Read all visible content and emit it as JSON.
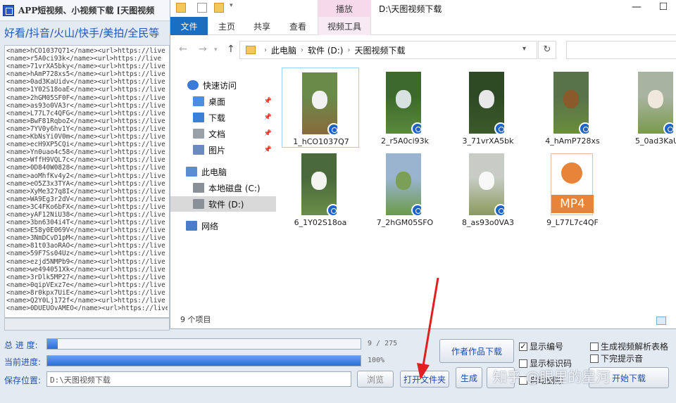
{
  "app": {
    "title": "APP短视频、小视频下载 [天图视频",
    "platforms": "好看/抖音/火山/快手/美拍/全民等",
    "log_lines": [
      "<name>hCO1037Q71</name><url>https://live",
      "<name>r5A0ci93k</name><url>https://live",
      "<name>71vrXA5bky</name><url>https://live",
      "<name>hAmP728xs5</name><url>https://live",
      "<name>0ad3KaUidv</name><url>https://live",
      "<name>1Y02S18oaE</name><url>https://live",
      "<name>2hGM05SF0F</name><url>https://live",
      "<name>as93o0VA3r</name><url>https://live",
      "<name>L77L7c4QFG</name><url>https://live",
      "<name>BwF81RqboZ</name><url>https://live",
      "<name>7YV0y6hv1Y</name><url>https://live",
      "<name>KbNsYi0V0m</name><url>https://live",
      "<name>ecH9XP5CQi</name><url>https://live",
      "<name>Yn0uao4c58</name><url>https://live",
      "<name>WffH9VQL7c</name><url>https://live",
      "<name>0D840W0828</name><url>https://live",
      "<name>aoMhfKv4y2</name><url>https://live",
      "<name>eO5Z3x3TYA</name><url>https://live",
      "<name>XyMe327q8I</name><url>https://live",
      "<name>WA9Eg3r2dV</name><url>https://live",
      "<name>3C4FKo6bFX</name><url>https://live",
      "<name>yAF12NiU38</name><url>https://live",
      "<name>3bn6304i4T</name><url>https://live",
      "<name>E58y0E069V</name><url>https://live",
      "<name>3NmDCvD1pM</name><url>https://live",
      "<name>81t03aoRAO</name><url>https://live",
      "<name>59F7Ss04Uz</name><url>https://live",
      "<name>ezjd5NMPb9</name><url>https://live",
      "<name>we494051Xk</name><url>https://live",
      "<name>3rDlk5MP27</name><url>https://live",
      "<name>0qipVExz7e</name><url>https://live",
      "<name>8r0kpx7UiE</name><url>https://live",
      "<name>Q2Y0Lj172f</name><url>https://live",
      "<name>0DUEUOvAMEO</name><url>https://live"
    ],
    "total_progress_label": "总 进 度:",
    "total_progress_text": "9 / 275",
    "total_progress_fraction": 0.033,
    "current_progress_label": "当前进度:",
    "current_progress_text": "100%",
    "current_progress_fraction": 1.0,
    "save_label": "保存位置:",
    "save_path": "D:\\天图视频下载",
    "browse_label": "浏览",
    "open_folder_label": "打开文件夹",
    "author_download_label": "作者作品下载",
    "generate_label": "生成",
    "start_label": "开始下载",
    "chk_show_number": "显示编号",
    "chk_show_id": "显示标识码",
    "chk_auto": "自动删除",
    "chk_gen_table": "生成视频解析表格",
    "chk_sound": "下完提示音",
    "watermark": "知乎 @眼里的星河"
  },
  "explorer": {
    "play_tab": "播放",
    "title_path": "D:\\天图视频下载",
    "ribbon_tabs": [
      "文件",
      "主页",
      "共享",
      "查看",
      "视频工具"
    ],
    "breadcrumb": [
      "此电脑",
      "软件 (D:)",
      "天图视频下载"
    ],
    "tree": [
      {
        "label": "快速访问",
        "icon": "star-icon",
        "pinned": false
      },
      {
        "label": "桌面",
        "icon": "desktop-icon",
        "pinned": true
      },
      {
        "label": "下载",
        "icon": "download-icon",
        "pinned": true
      },
      {
        "label": "文档",
        "icon": "document-icon",
        "pinned": true
      },
      {
        "label": "图片",
        "icon": "pictures-icon",
        "pinned": true
      },
      {
        "label": "此电脑",
        "icon": "computer-icon",
        "pinned": false
      },
      {
        "label": "本地磁盘 (C:)",
        "icon": "drive-icon",
        "pinned": false
      },
      {
        "label": "软件 (D:)",
        "icon": "drive-icon",
        "pinned": false
      },
      {
        "label": "网络",
        "icon": "network-icon",
        "pinned": false
      }
    ],
    "files": [
      {
        "name": "1_hCO1037Q7",
        "kind": "video",
        "sky": "#6a8a4a",
        "ground": "#8a6a3a",
        "subject": "#f2f2f2"
      },
      {
        "name": "2_r5A0ci93k",
        "kind": "video",
        "sky": "#3c6a2c",
        "ground": "#5a8a3c",
        "subject": "#d8e2e0"
      },
      {
        "name": "3_71vrXA5bk",
        "kind": "video",
        "sky": "#2e4a24",
        "ground": "#3c5a2a",
        "subject": "#e8e8e8"
      },
      {
        "name": "4_hAmP728xs",
        "kind": "video",
        "sky": "#58724a",
        "ground": "#6a8e3c",
        "subject": "#8a5a2a"
      },
      {
        "name": "5_0ad3KaU",
        "kind": "video",
        "sky": "#a8b4a0",
        "ground": "#7a9a4c",
        "subject": "#f0e8dc"
      },
      {
        "name": "6_1Y02S18oa",
        "kind": "video",
        "sky": "#4a6a3c",
        "ground": "#6a8e48",
        "subject": "#f4f4f0"
      },
      {
        "name": "7_2hGM05SFO",
        "kind": "video",
        "sky": "#9ab4d0",
        "ground": "#6a9a48",
        "subject": "#7aa058"
      },
      {
        "name": "8_as93o0VA3",
        "kind": "video",
        "sky": "#c8ccc4",
        "ground": "#8a9a5c",
        "subject": "#f8f8f8"
      },
      {
        "name": "9_L77L7c4QF",
        "kind": "mp4",
        "sky": "#ffffff",
        "ground": "#ffffff",
        "subject": "#e8833a"
      }
    ],
    "mp4_label": "MP4",
    "status": "9 个项目"
  },
  "colors": {
    "accent": "#1a6fc3",
    "arrow": "#e02020",
    "progress": "#2b6fd8"
  }
}
